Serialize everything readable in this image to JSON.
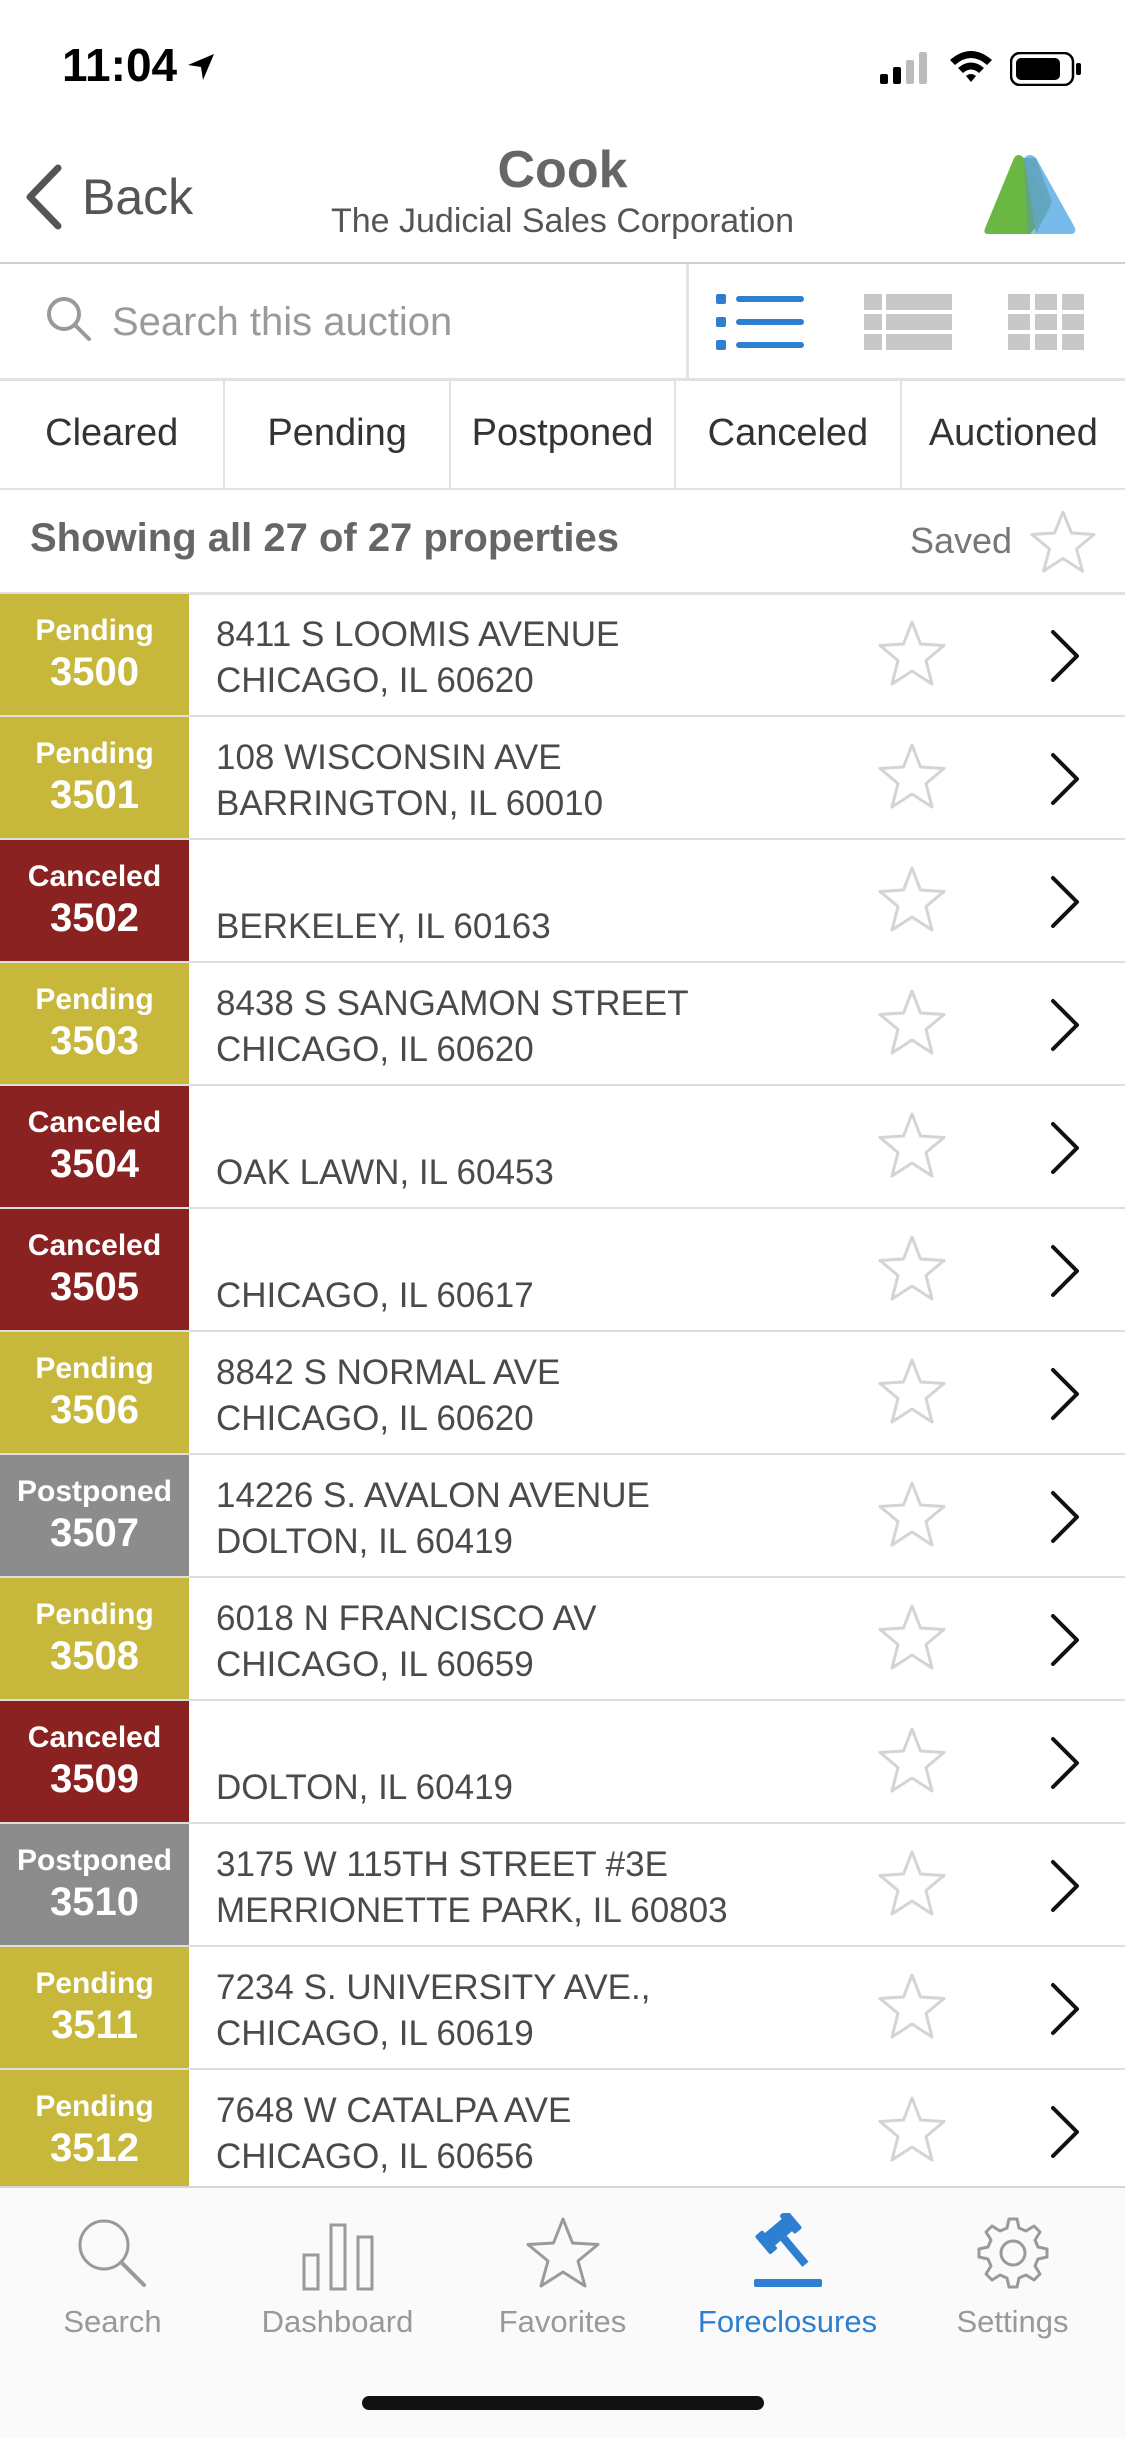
{
  "status_bar": {
    "time": "11:04"
  },
  "nav": {
    "back_label": "Back",
    "title": "Cook",
    "subtitle": "The Judicial Sales Corporation"
  },
  "search": {
    "placeholder": "Search this auction"
  },
  "filters": [
    "Cleared",
    "Pending",
    "Postponed",
    "Canceled",
    "Auctioned"
  ],
  "summary": {
    "text": "Showing all 27 of 27 properties",
    "saved_label": "Saved"
  },
  "status_colors": {
    "Pending": "#c7b73b",
    "Canceled": "#8b2222",
    "Postponed": "#8c8c8c"
  },
  "accent_color": "#2f7fd0",
  "properties": [
    {
      "status": "Pending",
      "number": "3500",
      "line1": "8411 S LOOMIS AVENUE",
      "line2": "CHICAGO, IL 60620"
    },
    {
      "status": "Pending",
      "number": "3501",
      "line1": "108 WISCONSIN AVE",
      "line2": "BARRINGTON, IL 60010"
    },
    {
      "status": "Canceled",
      "number": "3502",
      "line1": "",
      "line2": "BERKELEY, IL 60163"
    },
    {
      "status": "Pending",
      "number": "3503",
      "line1": "8438 S SANGAMON STREET",
      "line2": "CHICAGO, IL 60620"
    },
    {
      "status": "Canceled",
      "number": "3504",
      "line1": "",
      "line2": "OAK LAWN, IL 60453"
    },
    {
      "status": "Canceled",
      "number": "3505",
      "line1": "",
      "line2": "CHICAGO, IL 60617"
    },
    {
      "status": "Pending",
      "number": "3506",
      "line1": "8842 S NORMAL AVE",
      "line2": "CHICAGO, IL 60620"
    },
    {
      "status": "Postponed",
      "number": "3507",
      "line1": "14226 S. AVALON AVENUE",
      "line2": "DOLTON, IL 60419"
    },
    {
      "status": "Pending",
      "number": "3508",
      "line1": "6018 N FRANCISCO AV",
      "line2": "CHICAGO, IL 60659"
    },
    {
      "status": "Canceled",
      "number": "3509",
      "line1": "",
      "line2": "DOLTON, IL 60419"
    },
    {
      "status": "Postponed",
      "number": "3510",
      "line1": "3175 W 115TH STREET #3E",
      "line2": "MERRIONETTE PARK, IL 60803"
    },
    {
      "status": "Pending",
      "number": "3511",
      "line1": "7234 S. UNIVERSITY AVE.,",
      "line2": "CHICAGO, IL 60619"
    },
    {
      "status": "Pending",
      "number": "3512",
      "line1": "7648 W CATALPA AVE",
      "line2": "CHICAGO, IL 60656"
    }
  ],
  "tabs": [
    {
      "label": "Search",
      "icon": "search-icon"
    },
    {
      "label": "Dashboard",
      "icon": "bar-chart-icon"
    },
    {
      "label": "Favorites",
      "icon": "star-icon"
    },
    {
      "label": "Foreclosures",
      "icon": "gavel-icon",
      "active": true
    },
    {
      "label": "Settings",
      "icon": "gear-icon"
    }
  ]
}
